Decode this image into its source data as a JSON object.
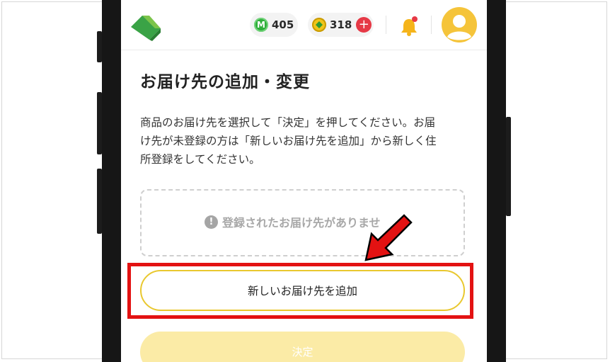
{
  "header": {
    "m_coin_symbol": "M",
    "m_points": "405",
    "coins": "318",
    "plus_symbol": "+"
  },
  "page": {
    "title": "お届け先の追加・変更",
    "description_lines": [
      "商品のお届け先を選択して「決定」を押してください。お届",
      "け先が未登録の方は「新しいお届け先を追加」から新しく住",
      "所登録をしてください。"
    ],
    "empty_message": "登録されたお届け先がありませ",
    "info_symbol": "!",
    "add_button_label": "新しいお届け先を追加",
    "decide_button_label": "決定"
  },
  "colors": {
    "accent_yellow": "#e9c82f",
    "highlight_red": "#e31212",
    "logo_green": "#3aa346",
    "disabled_button": "#fbeba6"
  },
  "icons": [
    "logo-icon",
    "m-coin-icon",
    "coin-icon",
    "plus-icon",
    "bell-icon",
    "avatar-icon",
    "info-icon",
    "arrow-annotation"
  ]
}
